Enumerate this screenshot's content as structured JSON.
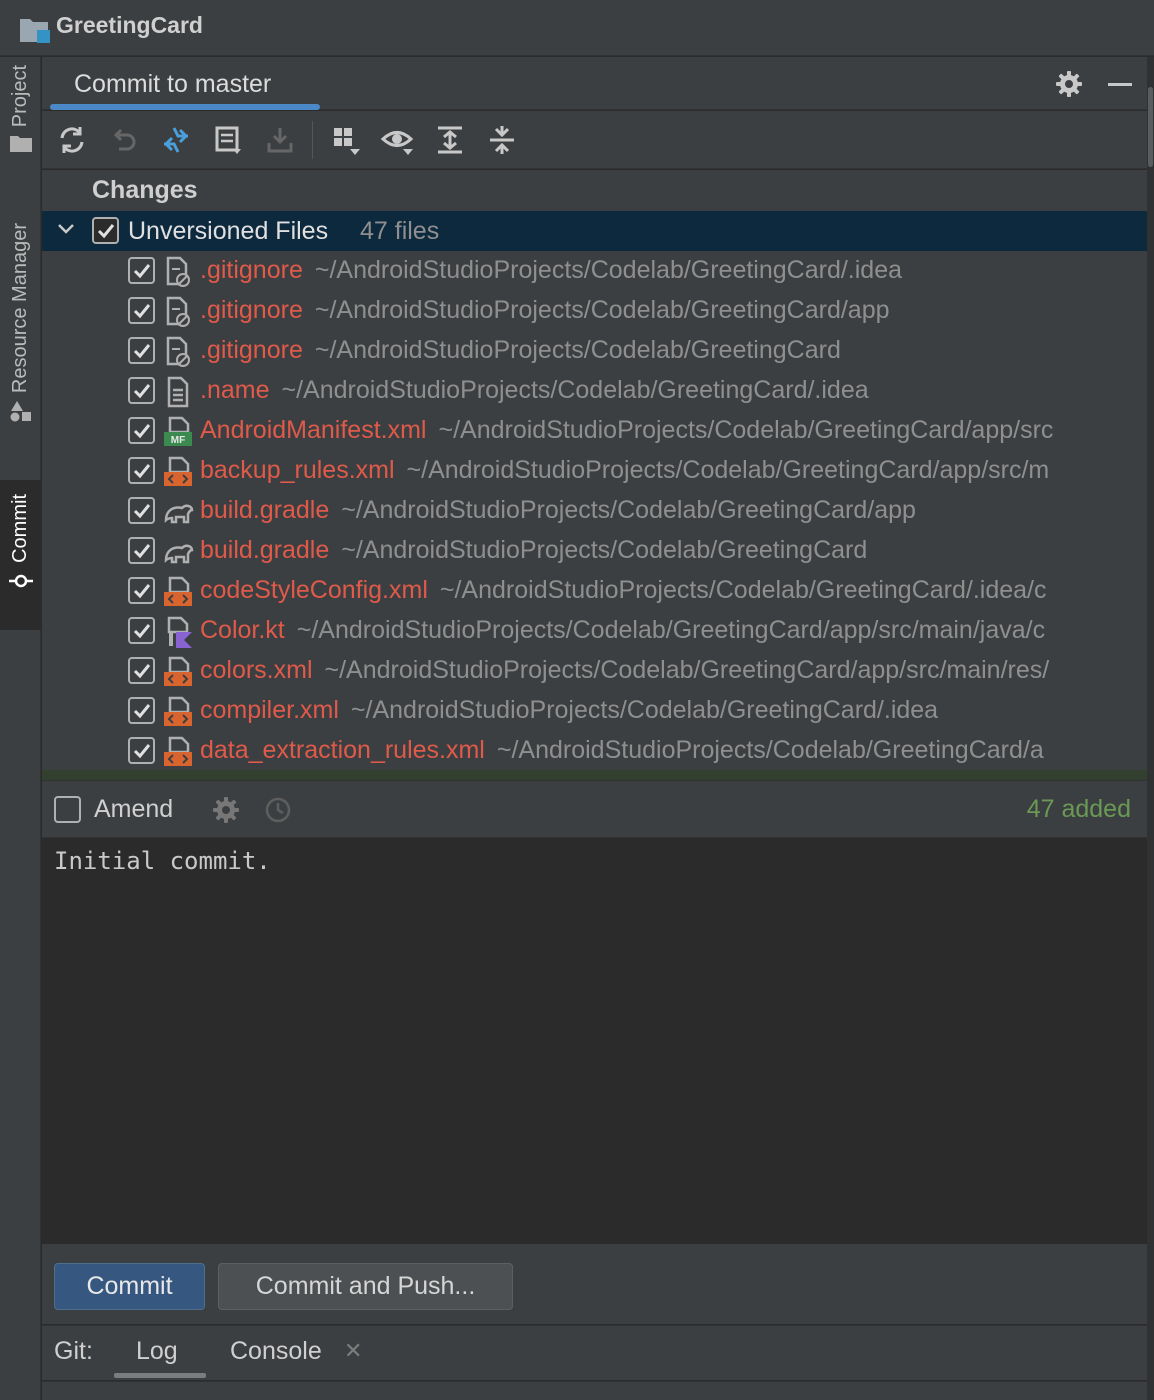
{
  "app": {
    "project_name": "GreetingCard"
  },
  "left_strip": {
    "tabs": [
      {
        "label": "Project"
      },
      {
        "label": "Resource Manager"
      },
      {
        "label": "Commit"
      }
    ]
  },
  "panel": {
    "title": "Commit to master"
  },
  "toolbar": {
    "icons": [
      "refresh-icon",
      "rollback-icon",
      "show-diff-icon",
      "edit-changelist-icon",
      "shelve-icon",
      "group-by-icon",
      "view-options-icon",
      "expand-all-icon",
      "collapse-all-icon"
    ]
  },
  "changes": {
    "header": "Changes",
    "group": {
      "name": "Unversioned Files",
      "count": "47 files"
    },
    "files": [
      {
        "name": ".gitignore",
        "path": "~/AndroidStudioProjects/Codelab/GreetingCard/.idea",
        "icon": "gitignore-file-icon"
      },
      {
        "name": ".gitignore",
        "path": "~/AndroidStudioProjects/Codelab/GreetingCard/app",
        "icon": "gitignore-file-icon"
      },
      {
        "name": ".gitignore",
        "path": "~/AndroidStudioProjects/Codelab/GreetingCard",
        "icon": "gitignore-file-icon"
      },
      {
        "name": ".name",
        "path": "~/AndroidStudioProjects/Codelab/GreetingCard/.idea",
        "icon": "text-file-icon"
      },
      {
        "name": "AndroidManifest.xml",
        "path": "~/AndroidStudioProjects/Codelab/GreetingCard/app/src",
        "icon": "manifest-file-icon"
      },
      {
        "name": "backup_rules.xml",
        "path": "~/AndroidStudioProjects/Codelab/GreetingCard/app/src/m",
        "icon": "xml-file-icon"
      },
      {
        "name": "build.gradle",
        "path": "~/AndroidStudioProjects/Codelab/GreetingCard/app",
        "icon": "gradle-file-icon"
      },
      {
        "name": "build.gradle",
        "path": "~/AndroidStudioProjects/Codelab/GreetingCard",
        "icon": "gradle-file-icon"
      },
      {
        "name": "codeStyleConfig.xml",
        "path": "~/AndroidStudioProjects/Codelab/GreetingCard/.idea/c",
        "icon": "xml-file-icon"
      },
      {
        "name": "Color.kt",
        "path": "~/AndroidStudioProjects/Codelab/GreetingCard/app/src/main/java/c",
        "icon": "kotlin-file-icon"
      },
      {
        "name": "colors.xml",
        "path": "~/AndroidStudioProjects/Codelab/GreetingCard/app/src/main/res/",
        "icon": "xml-file-icon"
      },
      {
        "name": "compiler.xml",
        "path": "~/AndroidStudioProjects/Codelab/GreetingCard/.idea",
        "icon": "xml-file-icon"
      },
      {
        "name": "data_extraction_rules.xml",
        "path": "~/AndroidStudioProjects/Codelab/GreetingCard/a",
        "icon": "xml-file-icon"
      }
    ]
  },
  "amend": {
    "label": "Amend",
    "checked": false,
    "status": "47 added"
  },
  "message": {
    "value": "Initial commit."
  },
  "buttons": {
    "commit": "Commit",
    "commit_push": "Commit and Push..."
  },
  "git": {
    "label": "Git:",
    "tabs": [
      "Log",
      "Console"
    ],
    "active_tab": "Log"
  },
  "colors": {
    "unversioned": "#e05a4a",
    "selection": "#0d293e",
    "accent": "#4a88c7",
    "added": "#6a9955",
    "primary_button": "#365880"
  }
}
